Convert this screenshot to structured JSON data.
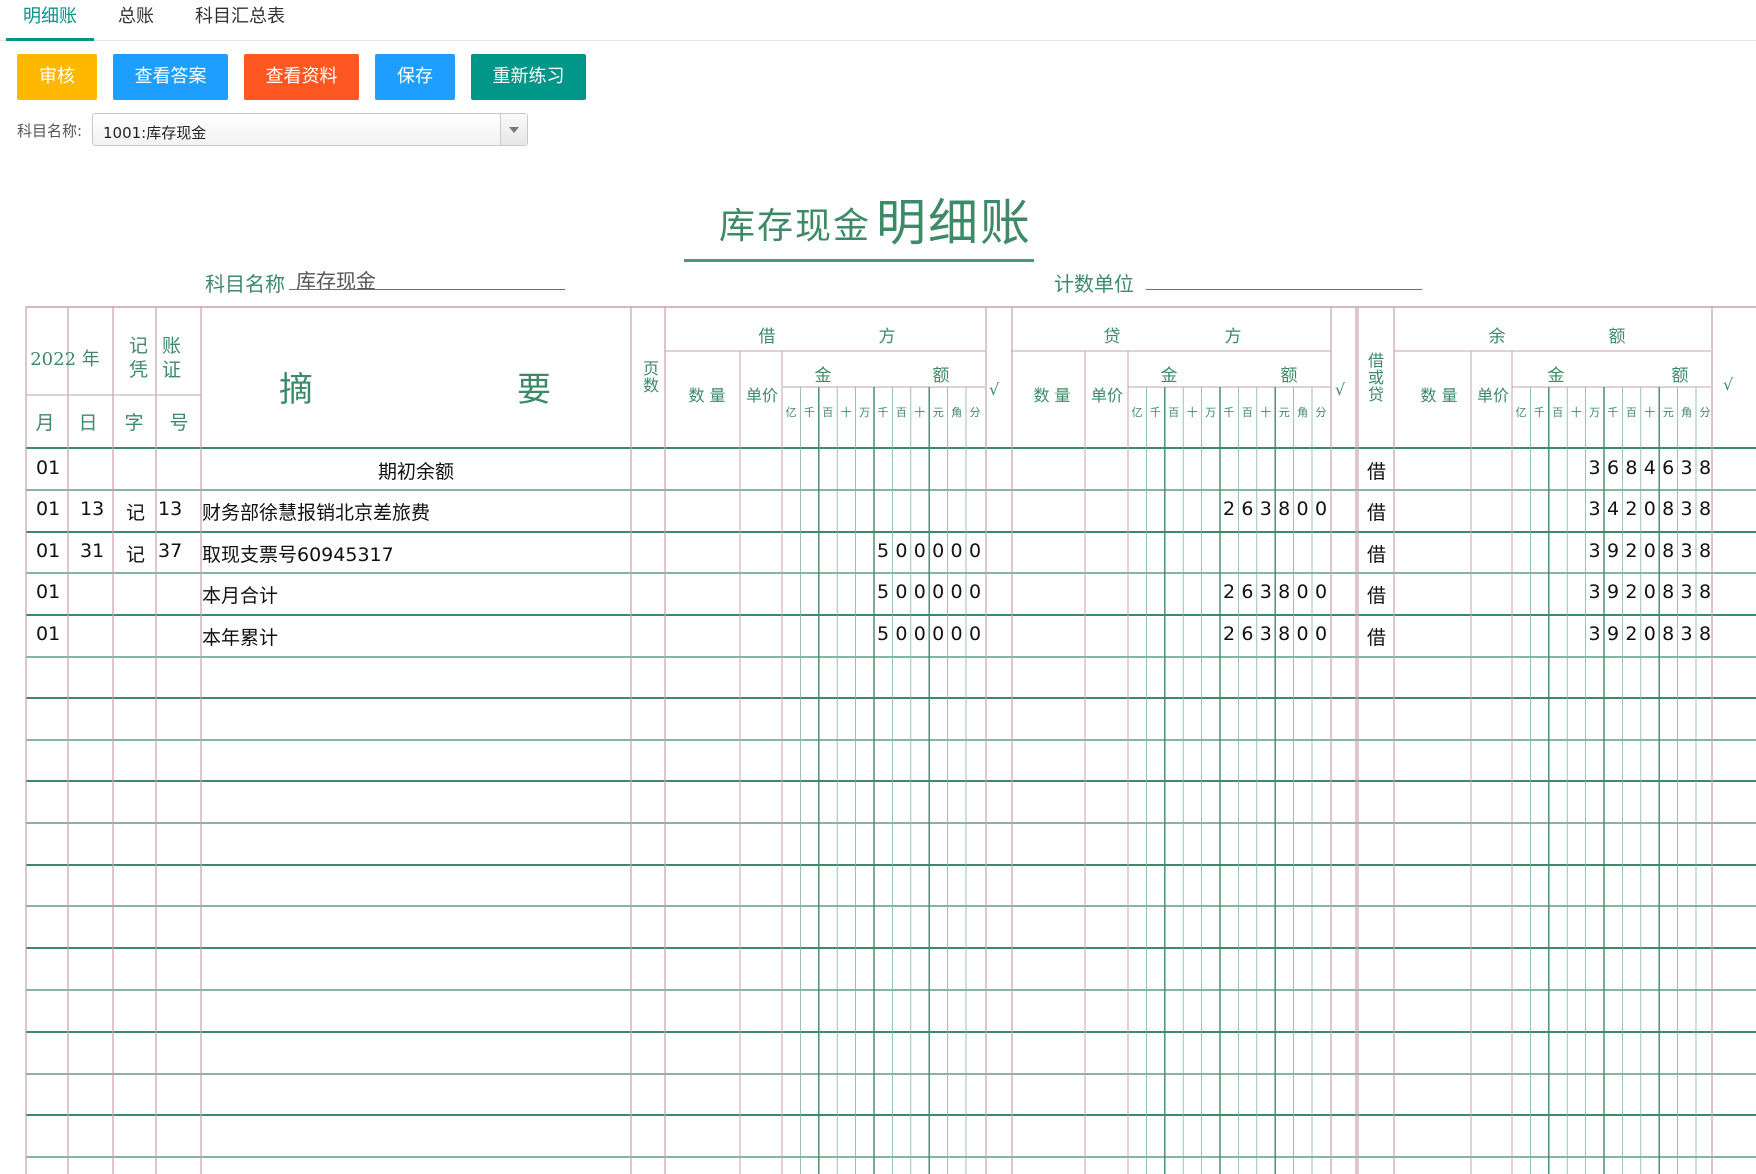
{
  "tabs": [
    {
      "label": "明细账",
      "active": true
    },
    {
      "label": "总账",
      "active": false
    },
    {
      "label": "科目汇总表",
      "active": false
    }
  ],
  "toolbar": {
    "buttons": [
      {
        "label": "审核",
        "color": "#FFB800"
      },
      {
        "label": "查看答案",
        "color": "#1E9FFF"
      },
      {
        "label": "查看资料",
        "color": "#FF5722"
      },
      {
        "label": "保存",
        "color": "#1E9FFF"
      },
      {
        "label": "重新练习",
        "color": "#009688"
      }
    ]
  },
  "subject_select": {
    "label": "科目名称:",
    "value": "1001:库存现金"
  },
  "ledger": {
    "title_sub": "库存现金",
    "title_main": "明细账",
    "subject_label": "科目名称",
    "subject_value": "库存现金",
    "unit_label": "计数单位",
    "unit_value": "",
    "header": {
      "year": "2022 年",
      "month": "月",
      "day": "日",
      "voucher_top": "记 账",
      "voucher_bottom": "凭 证",
      "voucher_type": "字",
      "voucher_no": "号",
      "summary_left": "摘",
      "summary_right": "要",
      "page": "页数",
      "debit_left": "借",
      "debit_right": "方",
      "credit_left": "贷",
      "credit_right": "方",
      "balance_left": "余",
      "balance_right": "额",
      "qty": "数 量",
      "price": "单价",
      "amount_left": "金",
      "amount_right": "额",
      "direction": "借或贷",
      "check": "√",
      "units": [
        "亿",
        "千",
        "百",
        "十",
        "万",
        "千",
        "百",
        "十",
        "元",
        "角",
        "分"
      ]
    },
    "rows": [
      {
        "month": "01",
        "day": "",
        "vtype": "",
        "vno": "",
        "summary": "期初余额",
        "centered": true,
        "debit": "",
        "credit": "",
        "dir": "借",
        "balance": "368463 8"
      },
      {
        "month": "01",
        "day": "13",
        "vtype": "记",
        "vno": "13",
        "summary": "财务部徐慧报销北京差旅费",
        "centered": false,
        "debit": "",
        "credit": "263800",
        "dir": "借",
        "balance": "3420838"
      },
      {
        "month": "01",
        "day": "31",
        "vtype": "记",
        "vno": "37",
        "summary": "取现支票号60945317",
        "centered": false,
        "debit": "500000",
        "credit": "",
        "dir": "借",
        "balance": "3920838"
      },
      {
        "month": "01",
        "day": "",
        "vtype": "",
        "vno": "",
        "summary": "本月合计",
        "centered": false,
        "debit": "500000",
        "credit": "263800",
        "dir": "借",
        "balance": "3920838"
      },
      {
        "month": "01",
        "day": "",
        "vtype": "",
        "vno": "",
        "summary": "本年累计",
        "centered": false,
        "debit": "500000",
        "credit": "263800",
        "dir": "借",
        "balance": "3920838"
      }
    ]
  },
  "colors": {
    "accent": "#009688",
    "ledger_green": "#3d8a68",
    "grid_red": "#c9a0b0"
  }
}
